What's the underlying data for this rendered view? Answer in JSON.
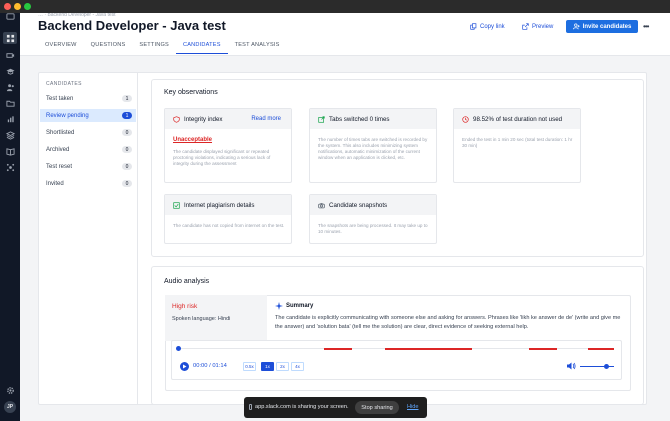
{
  "header": {
    "breadcrumb": "… · Backend Developer - Java test",
    "title": "Backend Developer - Java test",
    "copy_link": "Copy link",
    "preview": "Preview",
    "invite": "Invite candidates",
    "more": "•••"
  },
  "tabs": [
    "OVERVIEW",
    "QUESTIONS",
    "SETTINGS",
    "CANDIDATES",
    "TEST ANALYSIS"
  ],
  "active_tab": "CANDIDATES",
  "candidates": {
    "heading": "CANDIDATES",
    "items": [
      {
        "label": "Test taken",
        "count": "1"
      },
      {
        "label": "Review pending",
        "count": "1"
      },
      {
        "label": "Shortlisted",
        "count": "0"
      },
      {
        "label": "Archived",
        "count": "0"
      },
      {
        "label": "Test reset",
        "count": "0"
      },
      {
        "label": "Invited",
        "count": "0"
      }
    ],
    "active": "Review pending"
  },
  "observations": {
    "title": "Key observations",
    "integrity": {
      "title": "Integrity index",
      "read_more": "Read more",
      "status": "Unacceptable",
      "desc": "The candidate displayed significant or repeated proctoring violations, indicating a serious lack of integrity during the assessment"
    },
    "tabs_switched": {
      "title": "Tabs switched 0 times",
      "desc": "The number of times tabs are switched is recorded by the system. This also includes minimizing system notifications, automatic minimization of the current window when an application is clicked, etc."
    },
    "duration": {
      "title": "98.52% of test duration not used",
      "desc": "Ended the test in 1 min 20 sec (total test duration: 1 hr 30 min)"
    },
    "plagiarism": {
      "title": "Internet plagiarism details",
      "desc": "The candidate has not copied from internet on the test."
    },
    "snapshots": {
      "title": "Candidate snapshots",
      "desc": "The snapshots are being processed. It may take up to 10 minutes."
    }
  },
  "audio": {
    "title": "Audio analysis",
    "risk": "High risk",
    "language": "Spoken language: Hindi",
    "summary_title": "Summary",
    "summary": "The candidate is explicitly communicating with someone else and asking for answers. Phrases like 'likh ke answer de de' (write and give me the answer) and 'solution bata' (tell me the solution) are clear, direct evidence of seeking external help.",
    "time": "00:00 / 01:14",
    "speeds": [
      "0.5x",
      "1x",
      "2x",
      "4x"
    ],
    "active_speed": "1x",
    "flag_segments": [
      {
        "start": 0.335,
        "end": 0.4
      },
      {
        "start": 0.475,
        "end": 0.675
      },
      {
        "start": 0.805,
        "end": 0.87
      },
      {
        "start": 0.94,
        "end": 1.0
      }
    ],
    "volume": 0.78
  },
  "rail": {
    "avatar": "JP"
  },
  "toast": {
    "text": "app.slack.com is sharing your screen.",
    "stop": "Stop sharing",
    "hide": "Hide"
  },
  "colors": {
    "accent": "#1d4ed8",
    "danger": "#dc2626",
    "active_bg": "#dbeafe"
  }
}
